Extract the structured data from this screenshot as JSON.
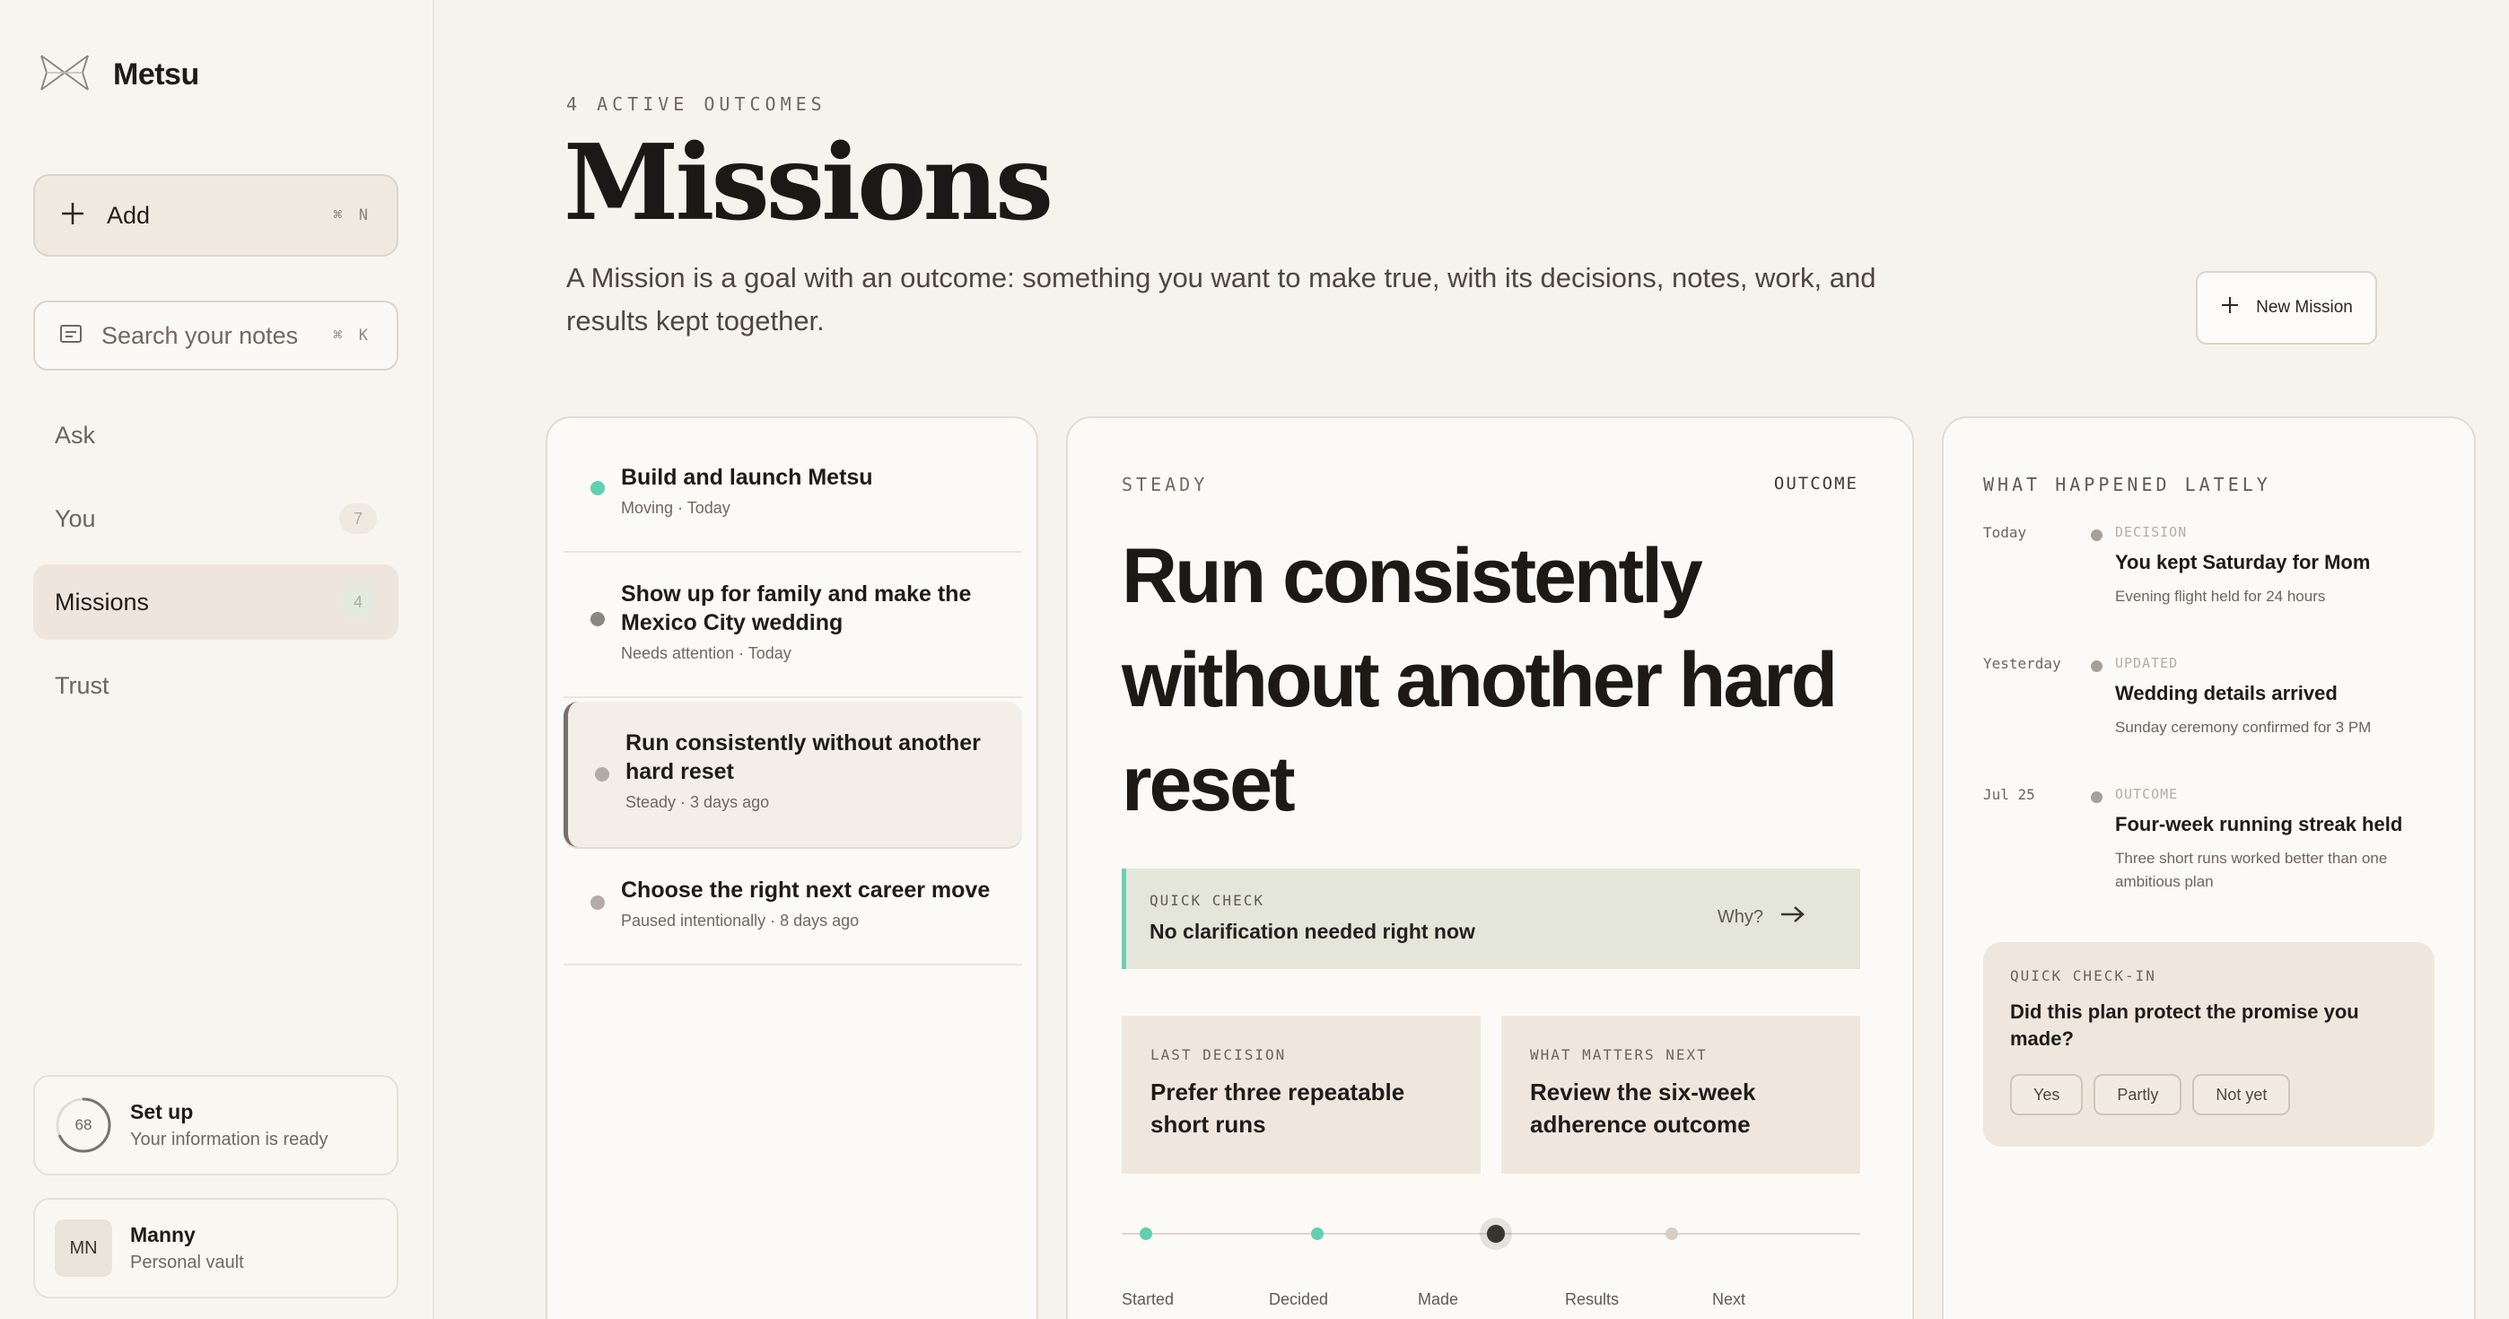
{
  "app": {
    "name": "Metsu"
  },
  "sidebar": {
    "add_label": "Add",
    "add_shortcut": "⌘ N",
    "search_placeholder": "Search your notes",
    "search_shortcut": "⌘ K",
    "nav": [
      {
        "label": "Ask",
        "badge": ""
      },
      {
        "label": "You",
        "badge": "7"
      },
      {
        "label": "Missions",
        "badge": "4",
        "active": true
      },
      {
        "label": "Trust",
        "badge": ""
      }
    ],
    "setup": {
      "progress": "68",
      "title": "Set up",
      "subtitle": "Your information is ready"
    },
    "user": {
      "initials": "MN",
      "name": "Manny",
      "subtitle": "Personal vault"
    }
  },
  "header": {
    "eyebrow": "4 ACTIVE OUTCOMES",
    "title": "Missions",
    "description": "A Mission is a goal with an outcome: something you want to make true, with its decisions, notes, work, and results kept together.",
    "new_mission_label": "New Mission"
  },
  "missions": [
    {
      "title": "Build and launch Metsu",
      "meta": "Moving · Today",
      "status_color": "#5fd0b1"
    },
    {
      "title": "Show up for family and make the Mexico City wedding",
      "meta": "Needs attention · Today",
      "status_color": "#8d8580"
    },
    {
      "title": "Run consistently without another hard reset",
      "meta": "Steady · 3 days ago",
      "status_color": "#b3aca6",
      "selected": true
    },
    {
      "title": "Choose the right next career move",
      "meta": "Paused intentionally · 8 days ago",
      "status_color": "#b3aca6"
    }
  ],
  "detail": {
    "status": "STEADY",
    "kind": "OUTCOME",
    "title": "Run consistently without another hard reset",
    "quick_check": {
      "label": "QUICK CHECK",
      "text": "No clarification needed right now",
      "why": "Why?"
    },
    "last_decision": {
      "label": "LAST DECISION",
      "text": "Prefer three repeatable short runs"
    },
    "next": {
      "label": "WHAT MATTERS NEXT",
      "text": "Review the six-week adherence outcome"
    },
    "timeline": [
      "Started",
      "Decided",
      "Made",
      "Results",
      "Next"
    ],
    "timeline_current": "Made",
    "accent": "#5fd0b1"
  },
  "feed": {
    "title": "WHAT HAPPENED LATELY",
    "items": [
      {
        "when": "Today",
        "kind": "DECISION",
        "title": "You kept Saturday for Mom",
        "sub": "Evening flight held for 24 hours"
      },
      {
        "when": "Yesterday",
        "kind": "UPDATED",
        "title": "Wedding details arrived",
        "sub": "Sunday ceremony confirmed for 3 PM"
      },
      {
        "when": "Jul 25",
        "kind": "OUTCOME",
        "title": "Four-week running streak held",
        "sub": "Three short runs worked better than one ambitious plan"
      }
    ],
    "checkin": {
      "label": "QUICK CHECK-IN",
      "question": "Did this plan protect the promise you made?",
      "options": [
        "Yes",
        "Partly",
        "Not yet"
      ]
    }
  }
}
